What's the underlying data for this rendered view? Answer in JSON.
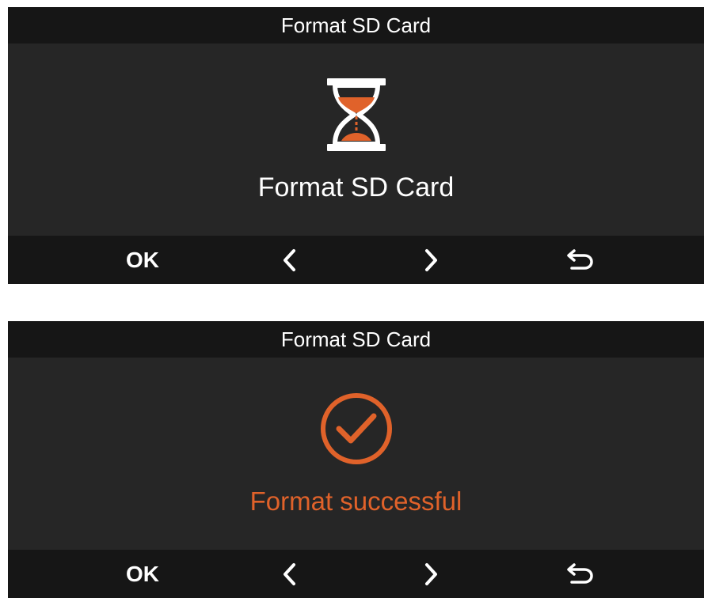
{
  "screens": [
    {
      "title": "Format SD Card",
      "icon": "hourglass-icon",
      "message": "Format SD Card",
      "buttons": {
        "ok": "OK",
        "prev": "prev-arrow-icon",
        "next": "next-arrow-icon",
        "back": "return-icon"
      }
    },
    {
      "title": "Format SD Card",
      "icon": "check-circle-icon",
      "message": "Format successful",
      "buttons": {
        "ok": "OK",
        "prev": "prev-arrow-icon",
        "next": "next-arrow-icon",
        "back": "return-icon"
      }
    }
  ],
  "colors": {
    "accent": "#e0622a",
    "panel": "#262626",
    "bar": "#161616",
    "text": "#ffffff"
  }
}
